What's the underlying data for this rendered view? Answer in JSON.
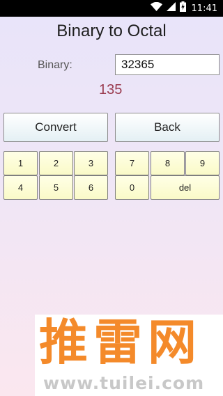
{
  "status_bar": {
    "time": "11:41",
    "icons": [
      "wifi-icon",
      "signal-icon",
      "battery-charging-icon"
    ]
  },
  "app": {
    "title": "Binary to Octal",
    "input_label": "Binary:",
    "input_value": "32365",
    "result": "135"
  },
  "buttons": {
    "convert": "Convert",
    "back": "Back"
  },
  "keypad": {
    "left": [
      "1",
      "2",
      "3",
      "4",
      "5",
      "6"
    ],
    "right": [
      "7",
      "8",
      "9",
      "0",
      "del"
    ]
  },
  "watermark": {
    "chars": "推雷网",
    "url": "www.tuilei.com"
  },
  "colors": {
    "result": "#9a3b4f",
    "key_bg": "#fafac8",
    "watermark_orange": "#f48a2a"
  }
}
